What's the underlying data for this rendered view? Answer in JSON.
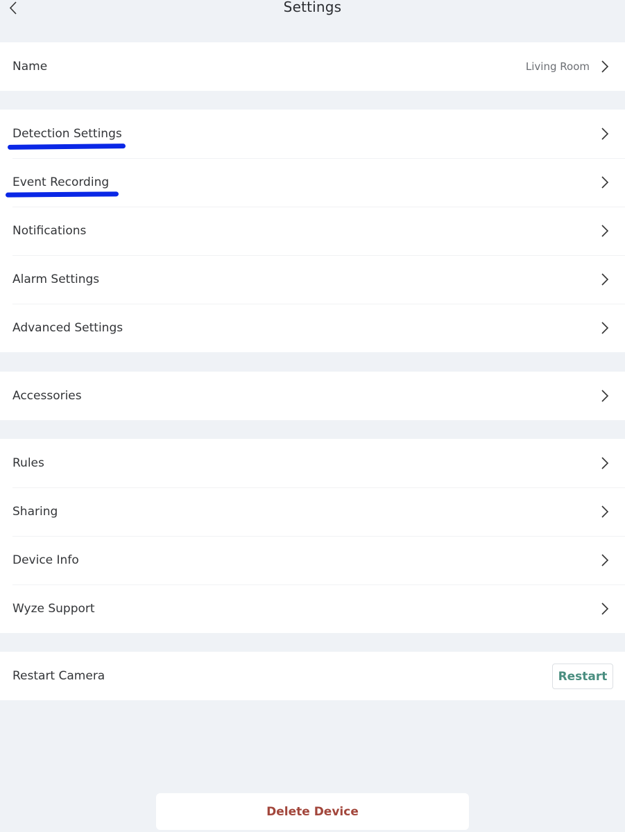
{
  "header": {
    "title": "Settings",
    "back_icon": "chevron-left-icon"
  },
  "groups": [
    {
      "items": [
        {
          "label": "Name",
          "value": "Living Room"
        }
      ]
    },
    {
      "items": [
        {
          "label": "Detection Settings",
          "annotated": true
        },
        {
          "label": "Event Recording",
          "annotated": true
        },
        {
          "label": "Notifications"
        },
        {
          "label": "Alarm Settings"
        },
        {
          "label": "Advanced Settings"
        }
      ]
    },
    {
      "items": [
        {
          "label": "Accessories"
        }
      ]
    },
    {
      "items": [
        {
          "label": "Rules"
        },
        {
          "label": "Sharing"
        },
        {
          "label": "Device Info"
        },
        {
          "label": "Wyze Support"
        }
      ]
    },
    {
      "items": [
        {
          "label": "Restart Camera",
          "button": "Restart"
        }
      ]
    }
  ],
  "delete_button": "Delete Device",
  "colors": {
    "background": "#eff2f6",
    "annotation": "#0a27e6",
    "restart_text": "#4a8e80",
    "delete_text": "#a2463b"
  }
}
